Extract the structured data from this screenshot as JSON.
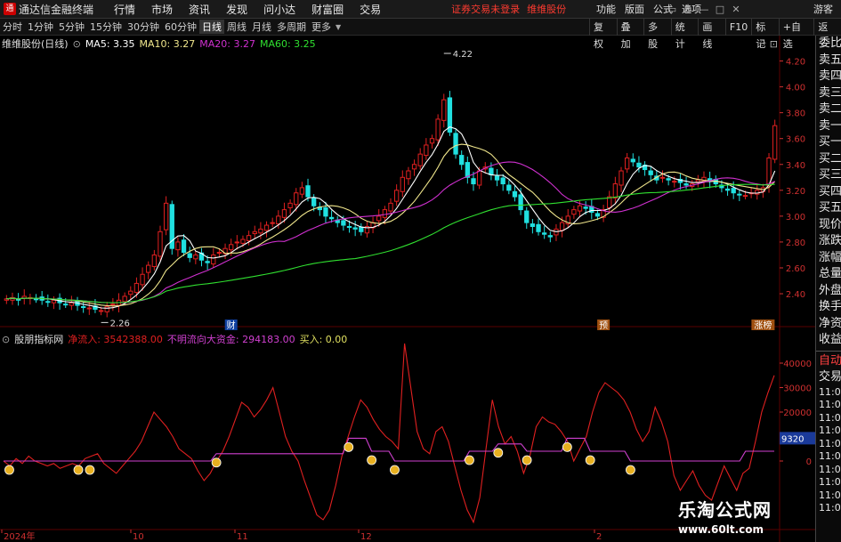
{
  "menubar": {
    "app_title": "通达信金融终端",
    "items": [
      "行情",
      "市场",
      "资讯",
      "发现",
      "问小达",
      "财富圈",
      "交易"
    ],
    "status_login": "证券交易未登录",
    "status_stock": "维维股份",
    "right_items": [
      "功能",
      "版面",
      "公式",
      "选项"
    ],
    "guest": "游客"
  },
  "toolbar": {
    "periods": [
      "分时",
      "1分钟",
      "5分钟",
      "15分钟",
      "30分钟",
      "60分钟",
      "日线",
      "周线",
      "月线",
      "多周期",
      "更多"
    ],
    "active_period": "日线",
    "tools": [
      "复权",
      "叠加",
      "多股",
      "统计",
      "画线",
      "F10",
      "标记",
      "+自选",
      "返回"
    ]
  },
  "main_legend": {
    "stock_label": "维维股份(日线)",
    "ma5": "MA5: 3.35",
    "ma10": "MA10: 3.27",
    "ma20": "MA20: 3.27",
    "ma60": "MA60: 3.25"
  },
  "sub_legend": {
    "indicator": "股朋指标网",
    "net_inflow": "净流入: 3542388.00",
    "unclear_capital": "不明流向大资金: 294183.00",
    "buy": "买入: 0.00"
  },
  "chart_data": [
    {
      "type": "candlestick",
      "title": "维维股份(日线)",
      "price_axis_ticks": [
        "4.20",
        "4.00",
        "3.80",
        "3.60",
        "3.40",
        "3.20",
        "3.00",
        "2.80",
        "2.60",
        "2.40"
      ],
      "ylim": [
        2.18,
        4.3
      ],
      "annotations": [
        {
          "text": "4.22",
          "kind": "high"
        },
        {
          "text": "2.26",
          "kind": "low"
        },
        {
          "text": "财",
          "kind": "event"
        },
        {
          "text": "预",
          "kind": "event"
        },
        {
          "text": "涨榜",
          "kind": "event"
        }
      ],
      "close": [
        2.36,
        2.37,
        2.35,
        2.38,
        2.37,
        2.36,
        2.35,
        2.34,
        2.35,
        2.33,
        2.32,
        2.33,
        2.31,
        2.3,
        2.29,
        2.28,
        2.27,
        2.3,
        2.32,
        2.35,
        2.38,
        2.42,
        2.48,
        2.55,
        2.62,
        2.7,
        2.88,
        3.1,
        2.75,
        2.8,
        2.72,
        2.68,
        2.7,
        2.66,
        2.64,
        2.7,
        2.72,
        2.75,
        2.78,
        2.8,
        2.82,
        2.85,
        2.88,
        2.9,
        2.93,
        2.95,
        3.0,
        3.05,
        3.1,
        3.18,
        3.22,
        3.15,
        3.08,
        3.05,
        3.0,
        2.98,
        2.95,
        2.93,
        2.92,
        2.9,
        2.88,
        2.92,
        2.95,
        3.0,
        3.05,
        3.1,
        3.2,
        3.3,
        3.35,
        3.4,
        3.48,
        3.55,
        3.6,
        3.75,
        3.9,
        3.65,
        3.48,
        3.4,
        3.3,
        3.25,
        3.35,
        3.38,
        3.32,
        3.28,
        3.25,
        3.2,
        3.15,
        3.05,
        2.95,
        2.92,
        2.88,
        2.86,
        2.84,
        2.9,
        2.95,
        3.0,
        3.05,
        3.08,
        3.06,
        3.03,
        3.0,
        3.05,
        3.15,
        3.25,
        3.35,
        3.45,
        3.42,
        3.38,
        3.36,
        3.32,
        3.28,
        3.3,
        3.28,
        3.27,
        3.26,
        3.24,
        3.25,
        3.28,
        3.3,
        3.27,
        3.25,
        3.22,
        3.2,
        3.18,
        3.17,
        3.16,
        3.18,
        3.2,
        3.22,
        3.45,
        3.7
      ],
      "series": [
        {
          "name": "MA5",
          "color": "#ffffff"
        },
        {
          "name": "MA10",
          "color": "#f0e68c"
        },
        {
          "name": "MA20",
          "color": "#d030d0"
        },
        {
          "name": "MA60",
          "color": "#30e030"
        }
      ]
    },
    {
      "type": "line",
      "title": "股朋指标网",
      "y_axis_ticks": [
        "40000",
        "30000",
        "20000",
        "10000",
        "0"
      ],
      "ylim": [
        -28000,
        48000
      ],
      "current_value_tag": "9320",
      "x_axis_ticks": [
        "2024年",
        "10",
        "11",
        "12",
        "2"
      ],
      "series": [
        {
          "name": "净流入",
          "color": "#e02020",
          "values": [
            0,
            -2000,
            1000,
            -1000,
            2000,
            0,
            -1000,
            -2000,
            -1000,
            -3000,
            -2000,
            -1000,
            -2000,
            1000,
            2000,
            3000,
            -1000,
            -3000,
            -5000,
            -2000,
            1000,
            4000,
            8000,
            14000,
            20000,
            17000,
            14000,
            10000,
            5000,
            3000,
            1000,
            -4000,
            -8000,
            -5000,
            0,
            4000,
            10000,
            17000,
            24000,
            22000,
            18000,
            21000,
            25000,
            30000,
            20000,
            10000,
            4000,
            0,
            -8000,
            -15000,
            -22000,
            -24000,
            -20000,
            -10000,
            2000,
            10000,
            18000,
            25000,
            22000,
            17000,
            13000,
            10000,
            8000,
            5000,
            48000,
            30000,
            12000,
            5000,
            3000,
            12000,
            14000,
            8000,
            -2000,
            -12000,
            -20000,
            -25000,
            -15000,
            5000,
            25000,
            14000,
            7000,
            10000,
            4000,
            -5000,
            2000,
            14000,
            18000,
            16000,
            15000,
            12000,
            8000,
            0,
            5000,
            10000,
            20000,
            28000,
            32000,
            30000,
            28000,
            25000,
            20000,
            13000,
            8000,
            12000,
            22000,
            16000,
            8000,
            -6000,
            -12000,
            -8000,
            -4000,
            -10000,
            -14000,
            -16000,
            -9000,
            -2000,
            -7000,
            -12000,
            -5000,
            -3000,
            8000,
            20000,
            28000,
            35000
          ]
        },
        {
          "name": "不明流向大资金",
          "color": "#d040d0",
          "values": [
            0,
            0,
            0,
            0,
            0,
            0,
            0,
            0,
            0,
            0,
            0,
            0,
            0,
            0,
            0,
            0,
            0,
            0,
            0,
            0,
            0,
            0,
            0,
            0,
            0,
            0,
            0,
            0,
            0,
            0,
            0,
            0,
            0,
            0,
            0,
            0,
            0,
            3000,
            3000,
            3000,
            3000,
            3000,
            3000,
            3000,
            3000,
            3000,
            3000,
            3000,
            3000,
            3000,
            3000,
            3000,
            3000,
            3000,
            3000,
            3000,
            3000,
            3000,
            3000,
            3000,
            9320,
            9320,
            9320,
            9320,
            4000,
            4000,
            4000,
            4000,
            0,
            0,
            0,
            0,
            0,
            0,
            0,
            0,
            0,
            0,
            0,
            0,
            0,
            4000,
            4000,
            4000,
            4000,
            4000,
            7000,
            7000,
            7000,
            7000,
            7000,
            4000,
            4000,
            4000,
            4000,
            4000,
            4000,
            4000,
            9320,
            9320,
            9320,
            9320,
            4000,
            4000,
            4000,
            4000,
            4000,
            4000,
            4000,
            0,
            0,
            0,
            0,
            0,
            0,
            0,
            0,
            0,
            0,
            0,
            0,
            0,
            0,
            0,
            0,
            0,
            0,
            0,
            0,
            4000,
            4000,
            4000,
            4000,
            4000,
            4000
          ]
        }
      ],
      "buy_signal_icon": "money-bag-icon",
      "buy_signal_count": 13
    }
  ],
  "sidepanel": {
    "items": [
      "委比",
      "卖五",
      "卖四",
      "卖三",
      "卖二",
      "卖一",
      "买一",
      "买二",
      "买三",
      "买四",
      "买五",
      "现价",
      "涨跌",
      "涨幅",
      "总量",
      "外盘",
      "换手",
      "净资",
      "收益"
    ],
    "bottom_items": [
      "自动",
      "交易"
    ],
    "times": [
      "11:07",
      "11:07",
      "11:07",
      "11:07",
      "11:07",
      "11:07",
      "11:07",
      "11:07",
      "11:07",
      "11:07"
    ]
  },
  "watermark": {
    "line1": "乐淘公式网",
    "line2": "www.60lt.com"
  },
  "colors": {
    "up": "#e02020",
    "down": "#20e0e0",
    "axis_text": "#d03030",
    "grid": "#5a0000"
  }
}
